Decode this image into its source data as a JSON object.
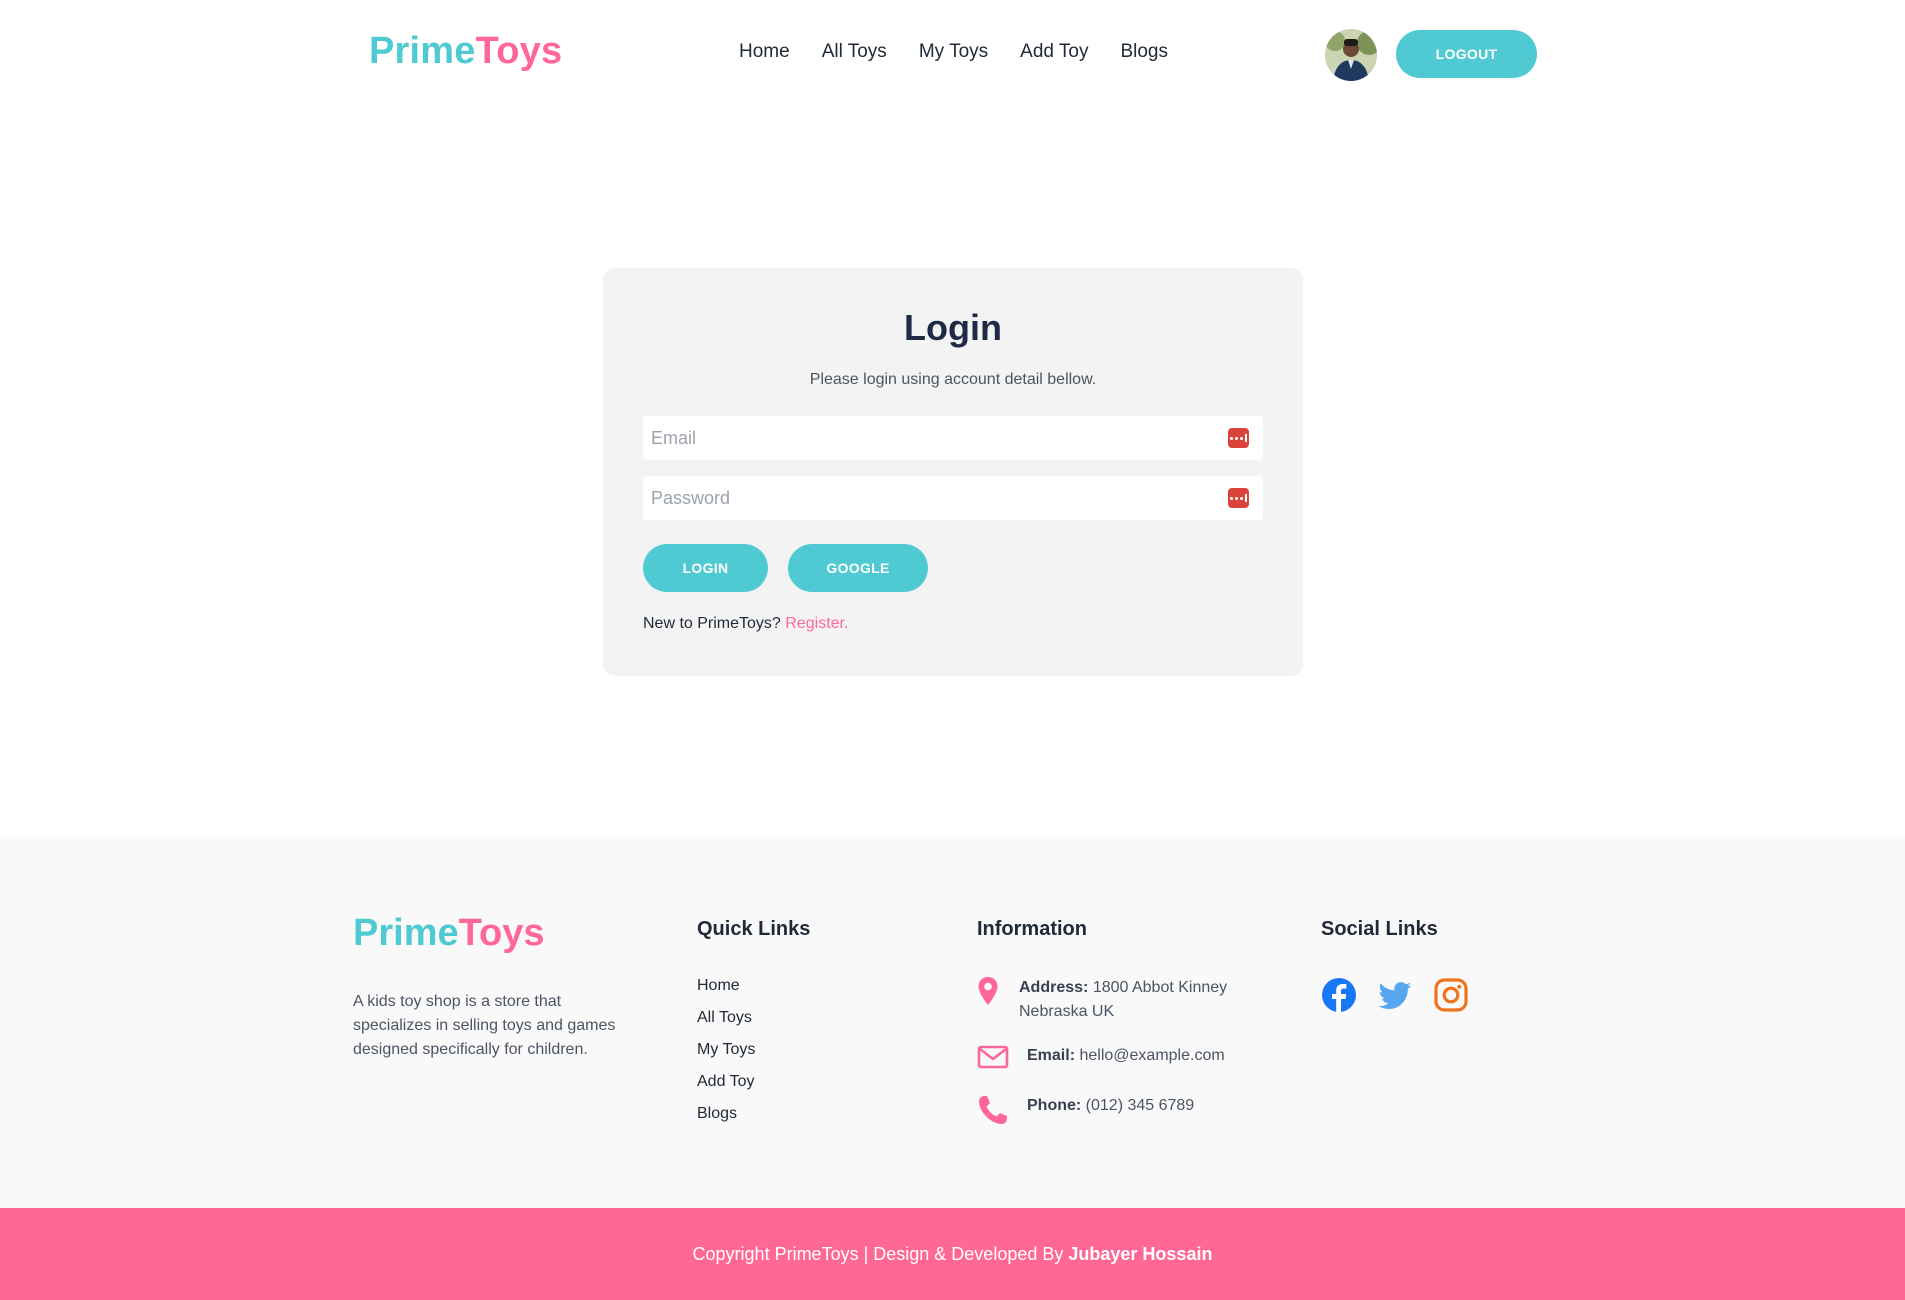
{
  "header": {
    "brand_part1": "Prime",
    "brand_part2": "Toys",
    "nav": [
      "Home",
      "All Toys",
      "My Toys",
      "Add Toy",
      "Blogs"
    ],
    "logout_label": "LOGOUT"
  },
  "login": {
    "title": "Login",
    "subtitle": "Please login using account detail bellow.",
    "email_placeholder": "Email",
    "email_value": "",
    "password_placeholder": "Password",
    "password_value": "",
    "login_label": "LOGIN",
    "google_label": "GOOGLE",
    "register_prompt": "New to PrimeToys?",
    "register_link": "Register."
  },
  "footer": {
    "brand_part1": "Prime",
    "brand_part2": "Toys",
    "description": "A kids toy shop is a store that specializes in selling toys and games designed specifically for children.",
    "quick_links_heading": "Quick Links",
    "quick_links": [
      "Home",
      "All Toys",
      "My Toys",
      "Add Toy",
      "Blogs"
    ],
    "information_heading": "Information",
    "address_label": "Address:",
    "address_line1": "1800 Abbot Kinney",
    "address_line2": "Nebraska UK",
    "email_label": "Email:",
    "email_value": "hello@example.com",
    "phone_label": "Phone:",
    "phone_value": "(012) 345 6789",
    "social_heading": "Social Links",
    "social_icons": [
      "facebook-icon",
      "twitter-icon",
      "instagram-icon"
    ],
    "copyright_prefix": "Copyright PrimeToys | Design & Developed By",
    "copyright_author": "Jubayer Hossain"
  },
  "colors": {
    "accent_teal": "#4fcad3",
    "accent_pink": "#ff6896",
    "card_bg": "#f3f3f3",
    "footer_bg": "#f9f9f9"
  }
}
